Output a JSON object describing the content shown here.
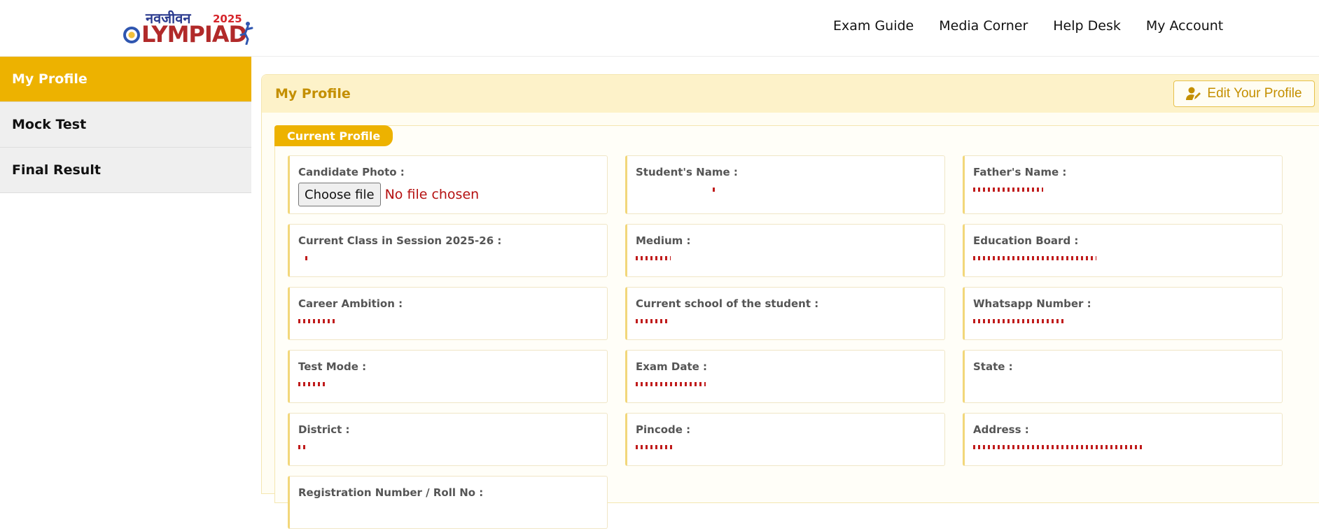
{
  "header": {
    "logo": {
      "hindi": "नवजीवन",
      "year": "2025",
      "word": "LYMPIAD"
    },
    "nav": [
      {
        "label": "Exam Guide"
      },
      {
        "label": "Media Corner"
      },
      {
        "label": "Help Desk"
      },
      {
        "label": "My Account"
      }
    ]
  },
  "sidebar": {
    "items": [
      {
        "label": "My Profile"
      },
      {
        "label": "Mock Test"
      },
      {
        "label": "Final Result"
      }
    ]
  },
  "main": {
    "title": "My Profile",
    "edit_button": "Edit Your Profile",
    "panel_tab": "Current Profile",
    "photo": {
      "label": "Candidate Photo :",
      "button": "Choose file",
      "status": "No file chosen"
    },
    "fields": [
      {
        "label": "Student's Name :",
        "value": ""
      },
      {
        "label": "Father's Name :",
        "value": ""
      },
      {
        "label": "Current Class in Session 2025-26 :",
        "value": ""
      },
      {
        "label": "Medium :",
        "value": ""
      },
      {
        "label": "Education Board :",
        "value": ""
      },
      {
        "label": "Career Ambition :",
        "value": ""
      },
      {
        "label": "Current school of the student :",
        "value": ""
      },
      {
        "label": "Whatsapp Number :",
        "value": ""
      },
      {
        "label": "Test Mode :",
        "value": ""
      },
      {
        "label": "Exam Date :",
        "value": ""
      },
      {
        "label": "State :",
        "value": ""
      },
      {
        "label": "District :",
        "value": ""
      },
      {
        "label": "Pincode :",
        "value": ""
      },
      {
        "label": "Address :",
        "value": ""
      },
      {
        "label": "Registration Number / Roll No :",
        "value": ""
      }
    ]
  },
  "colors": {
    "accent": "#edb200",
    "header_bg": "#fdf2c9",
    "value_text": "#b51111"
  }
}
